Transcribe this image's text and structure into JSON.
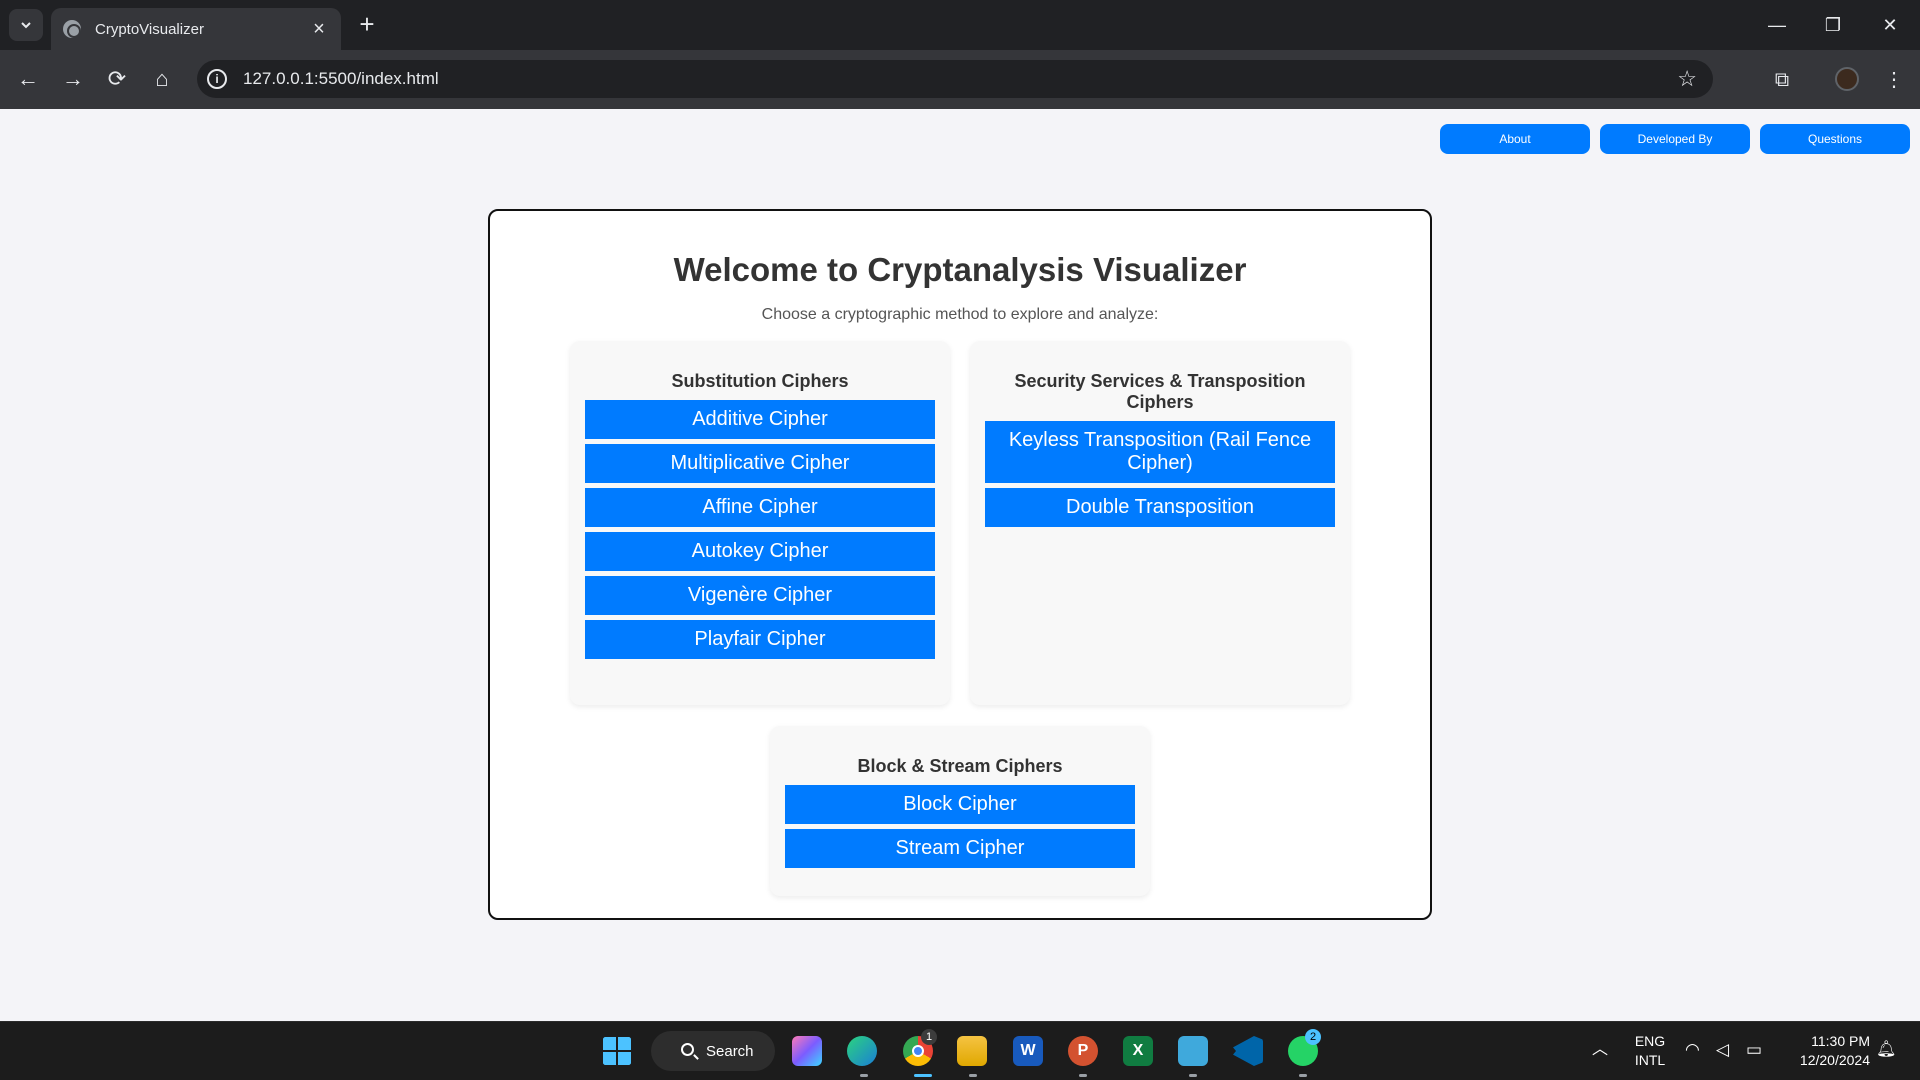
{
  "browser": {
    "tab_title": "CryptoVisualizer",
    "url": "127.0.0.1:5500/index.html"
  },
  "topnav": {
    "about": "About",
    "developed_by": "Developed By",
    "questions": "Questions"
  },
  "main": {
    "title": "Welcome to Cryptanalysis Visualizer",
    "subtitle": "Choose a cryptographic method to explore and analyze:"
  },
  "sections": {
    "substitution": {
      "title": "Substitution Ciphers",
      "buttons": [
        "Additive Cipher",
        "Multiplicative Cipher",
        "Affine Cipher",
        "Autokey Cipher",
        "Vigenère Cipher",
        "Playfair Cipher"
      ]
    },
    "transposition": {
      "title": "Security Services & Transposition Ciphers",
      "buttons": [
        "Keyless Transposition (Rail Fence Cipher)",
        "Double Transposition"
      ]
    },
    "block_stream": {
      "title": "Block & Stream Ciphers",
      "buttons": [
        "Block Cipher",
        "Stream Cipher"
      ]
    }
  },
  "taskbar": {
    "search_label": "Search",
    "lang_line1": "ENG",
    "lang_line2": "INTL",
    "time": "11:30 PM",
    "date": "12/20/2024",
    "whatsapp_badge": "2",
    "chrome_badge": "1"
  },
  "colors": {
    "accent": "#007bff",
    "page_bg": "#f4f4f8",
    "chrome_dark": "#202124"
  }
}
